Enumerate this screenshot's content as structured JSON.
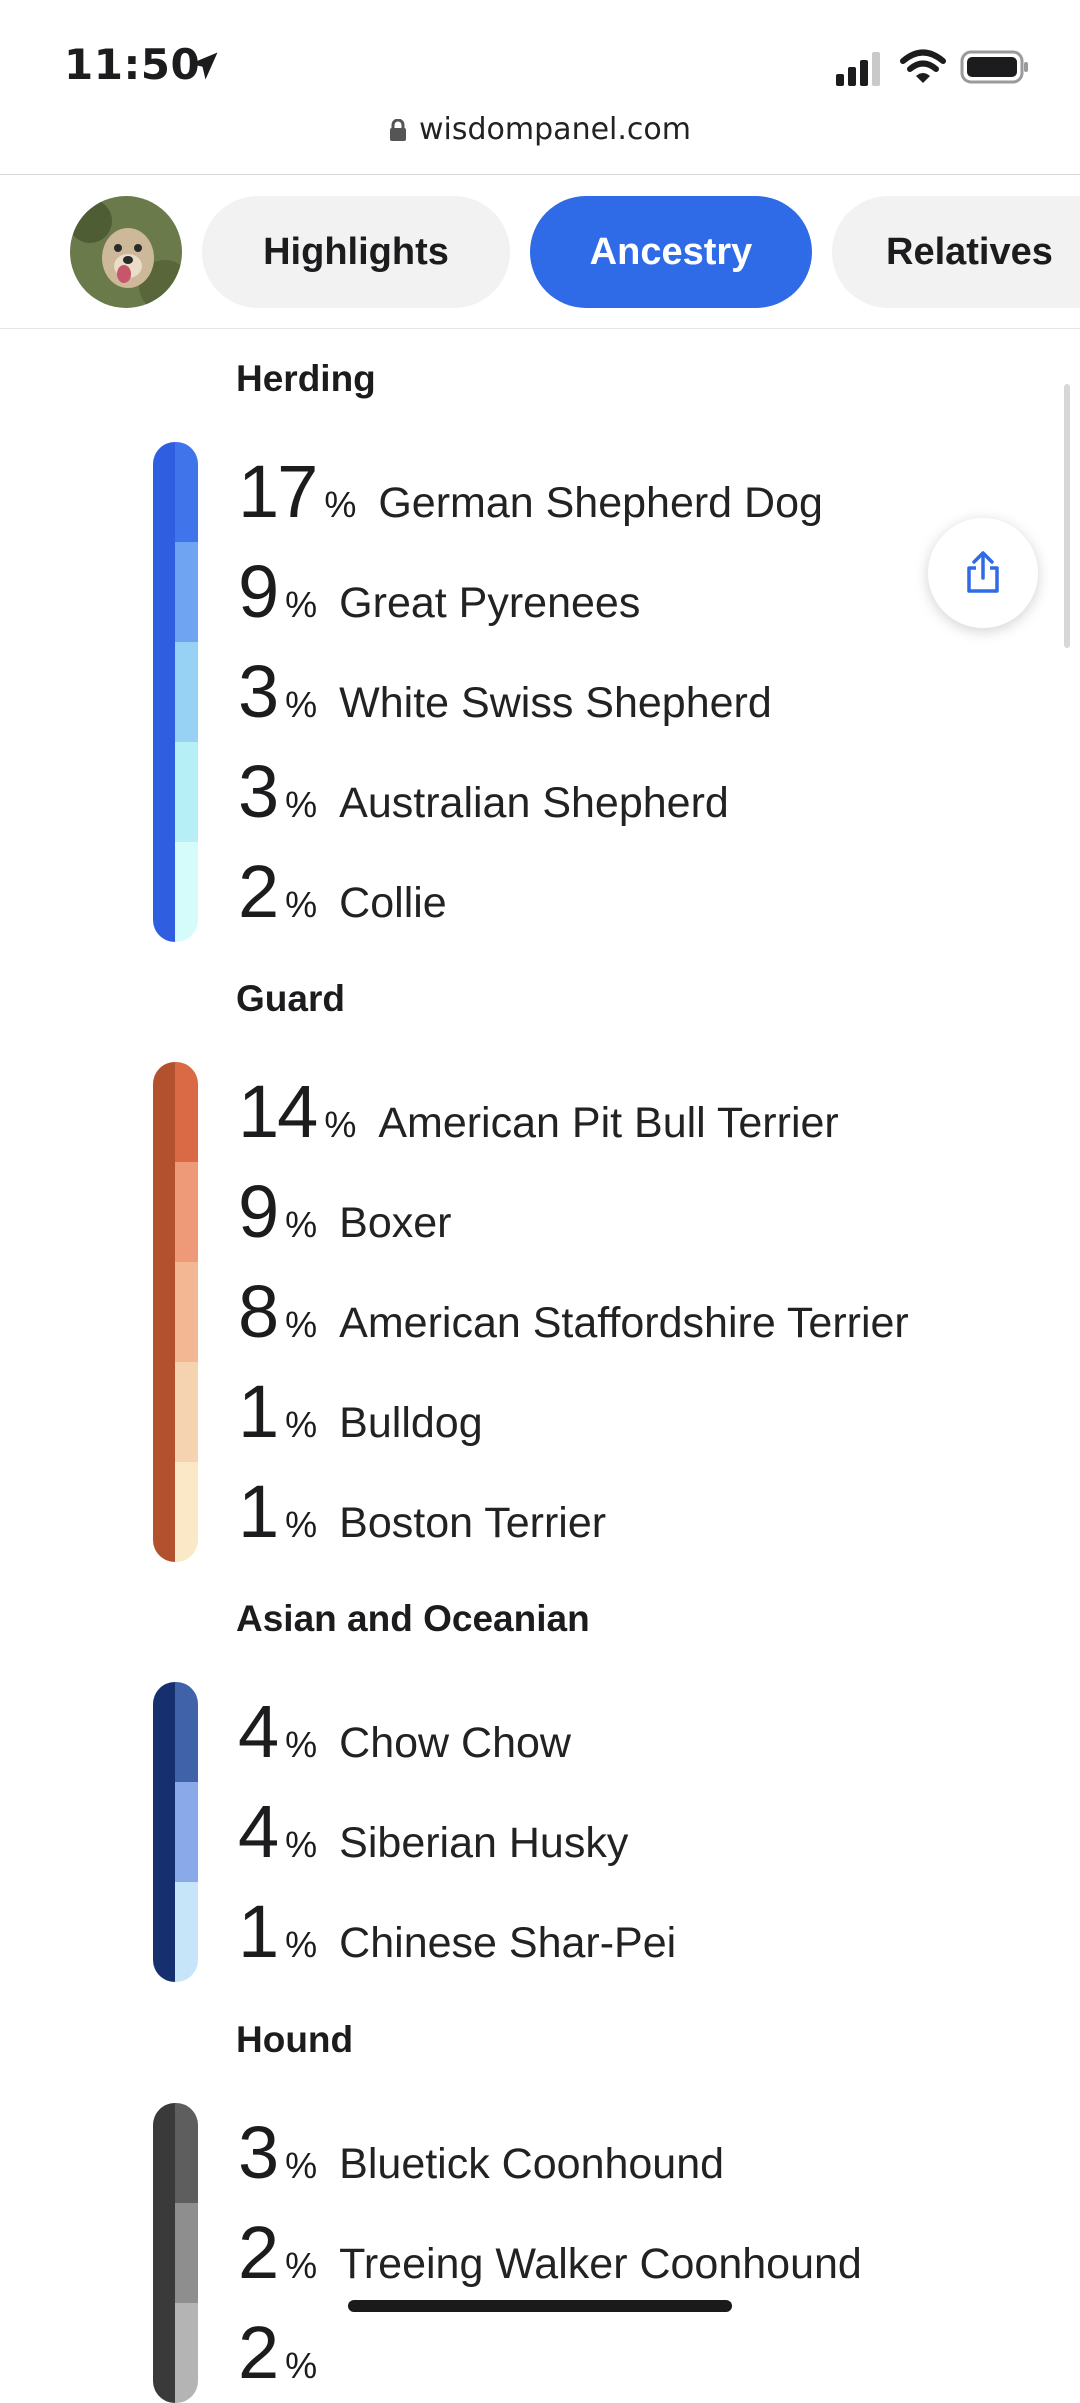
{
  "status_bar": {
    "time": "11:50"
  },
  "browser": {
    "url": "wisdompanel.com"
  },
  "tabs": [
    {
      "label": "Highlights",
      "active": false
    },
    {
      "label": "Ancestry",
      "active": true
    },
    {
      "label": "Relatives",
      "active": false
    }
  ],
  "colors": {
    "accent": "#2f6be6",
    "tab_bg": "#f2f2f2"
  },
  "sections": [
    {
      "title": "Herding",
      "strip_color": "#2f5fe0",
      "breeds": [
        {
          "percent": "17",
          "name": "German Shepherd Dog",
          "color": "#3f74ea"
        },
        {
          "percent": "9",
          "name": "Great Pyrenees",
          "color": "#6ea4f2"
        },
        {
          "percent": "3",
          "name": "White Swiss Shepherd",
          "color": "#97d2f4"
        },
        {
          "percent": "3",
          "name": "Australian Shepherd",
          "color": "#b6f0f6"
        },
        {
          "percent": "2",
          "name": "Collie",
          "color": "#d6fbfb"
        }
      ]
    },
    {
      "title": "Guard",
      "strip_color": "#b3502e",
      "breeds": [
        {
          "percent": "14",
          "name": "American Pit Bull Terrier",
          "color": "#d96a45"
        },
        {
          "percent": "9",
          "name": "Boxer",
          "color": "#ee9a78"
        },
        {
          "percent": "8",
          "name": "American Staffordshire Terrier",
          "color": "#f4b794"
        },
        {
          "percent": "1",
          "name": "Bulldog",
          "color": "#f6d3b0"
        },
        {
          "percent": "1",
          "name": "Boston Terrier",
          "color": "#fbe8c7"
        }
      ]
    },
    {
      "title": "Asian and Oceanian",
      "strip_color": "#16306f",
      "breeds": [
        {
          "percent": "4",
          "name": "Chow Chow",
          "color": "#3f62a8"
        },
        {
          "percent": "4",
          "name": "Siberian Husky",
          "color": "#8aa9e8"
        },
        {
          "percent": "1",
          "name": "Chinese Shar-Pei",
          "color": "#c7e5f8"
        }
      ]
    },
    {
      "title": "Hound",
      "strip_color": "#3a3a3a",
      "breeds": [
        {
          "percent": "3",
          "name": "Bluetick Coonhound",
          "color": "#5e5e5e"
        },
        {
          "percent": "2",
          "name": "Treeing Walker Coonhound",
          "color": "#8e8e8e"
        },
        {
          "percent": "2",
          "name": "",
          "color": "#b4b4b4"
        }
      ]
    }
  ],
  "labels": {
    "percent_sign": "%"
  }
}
